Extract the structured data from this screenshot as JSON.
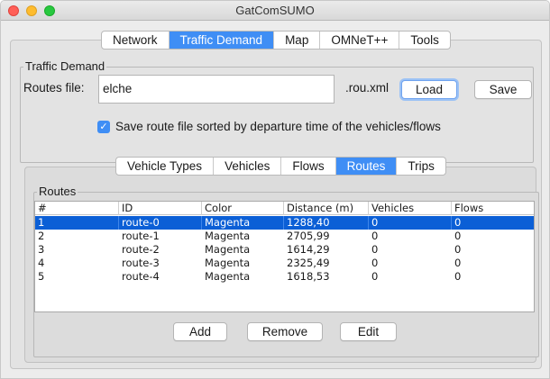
{
  "window": {
    "title": "GatComSUMO"
  },
  "main_tabs": [
    {
      "label": "Network",
      "active": false
    },
    {
      "label": "Traffic Demand",
      "active": true
    },
    {
      "label": "Map",
      "active": false
    },
    {
      "label": "OMNeT++",
      "active": false
    },
    {
      "label": "Tools",
      "active": false
    }
  ],
  "traffic_demand": {
    "group_title": "Traffic Demand",
    "routes_file_label": "Routes file:",
    "routes_file_value": "elche",
    "extension_label": ".rou.xml",
    "load_label": "Load",
    "save_label": "Save",
    "sort_checkbox_label": "Save route file sorted by departure time of the vehicles/flows",
    "sort_checked": true
  },
  "sub_tabs": [
    {
      "label": "Vehicle Types",
      "active": false
    },
    {
      "label": "Vehicles",
      "active": false
    },
    {
      "label": "Flows",
      "active": false
    },
    {
      "label": "Routes",
      "active": true
    },
    {
      "label": "Trips",
      "active": false
    }
  ],
  "routes": {
    "group_title": "Routes",
    "columns": [
      "#",
      "ID",
      "Color",
      "Distance (m)",
      "Vehicles",
      "Flows"
    ],
    "rows": [
      [
        "1",
        "route-0",
        "Magenta",
        "1288,40",
        "0",
        "0"
      ],
      [
        "2",
        "route-1",
        "Magenta",
        "2705,99",
        "0",
        "0"
      ],
      [
        "3",
        "route-2",
        "Magenta",
        "1614,29",
        "0",
        "0"
      ],
      [
        "4",
        "route-3",
        "Magenta",
        "2325,49",
        "0",
        "0"
      ],
      [
        "5",
        "route-4",
        "Magenta",
        "1618,53",
        "0",
        "0"
      ]
    ],
    "selected_row": 0,
    "add_label": "Add",
    "remove_label": "Remove",
    "edit_label": "Edit"
  },
  "colors": {
    "accent": "#3f8ef5",
    "selection": "#0b5fd6"
  }
}
